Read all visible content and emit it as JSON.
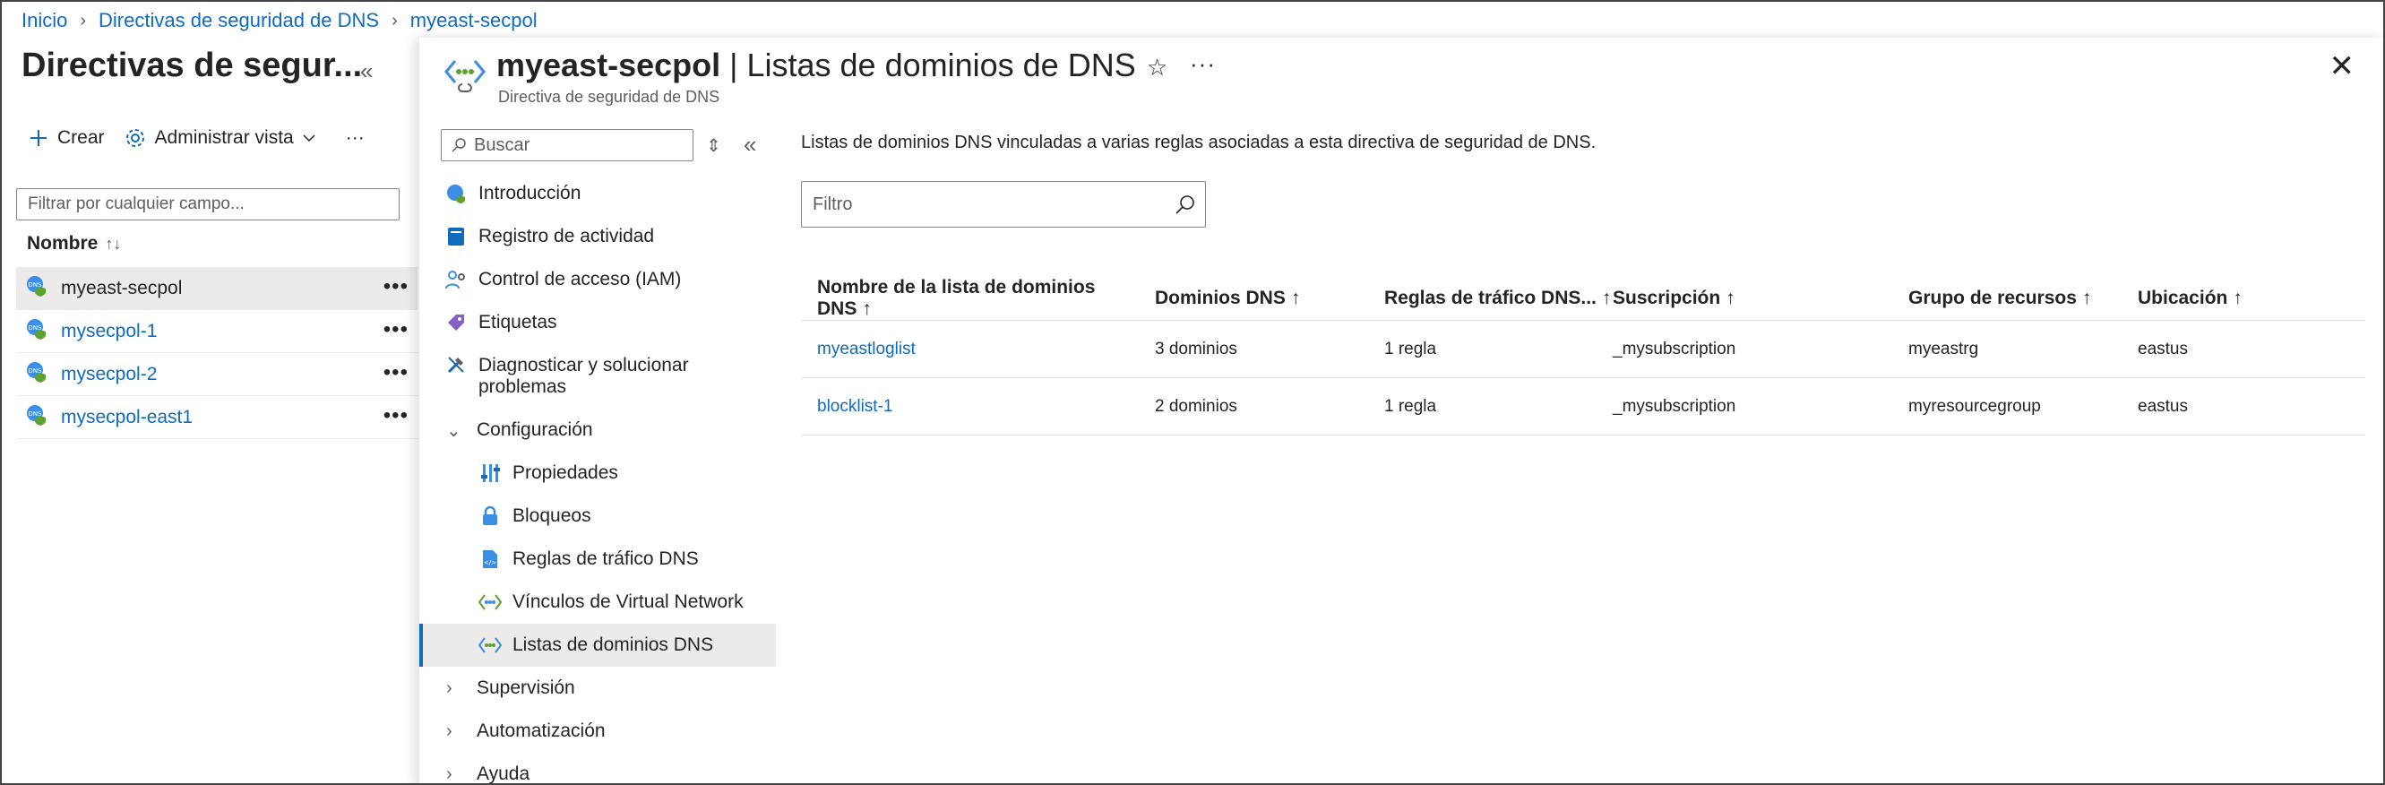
{
  "breadcrumb": [
    "Inicio",
    "Directivas de seguridad de DNS",
    "myeast-secpol"
  ],
  "left_panel": {
    "title": "Directivas de segur...",
    "collapse_icon": "«",
    "toolbar": {
      "create_label": "Crear",
      "manage_view_label": "Administrar vista",
      "more": "···"
    },
    "filter_placeholder": "Filtrar por cualquier campo...",
    "column_name": "Nombre",
    "items": [
      {
        "name": "myeast-secpol",
        "selected": true
      },
      {
        "name": "mysecpol-1",
        "selected": false
      },
      {
        "name": "mysecpol-2",
        "selected": false
      },
      {
        "name": "mysecpol-east1",
        "selected": false
      }
    ]
  },
  "blade": {
    "resource_name": "myeast-secpol",
    "separator": " | ",
    "page_name": "Listas de dominios de DNS",
    "subtitle": "Directiva de seguridad de DNS",
    "star_icon": "☆",
    "more": "···",
    "close_icon": "✕"
  },
  "nav": {
    "search_placeholder": "Buscar",
    "items": [
      {
        "label": "Introducción",
        "icon": "overview-icon"
      },
      {
        "label": "Registro de actividad",
        "icon": "activity-log-icon"
      },
      {
        "label": "Control de acceso (IAM)",
        "icon": "iam-icon"
      },
      {
        "label": "Etiquetas",
        "icon": "tags-icon"
      },
      {
        "label": "Diagnosticar y solucionar problemas",
        "icon": "diagnose-icon"
      },
      {
        "label": "Configuración",
        "icon": "chevron-down-icon"
      },
      {
        "label": "Propiedades",
        "icon": "properties-icon"
      },
      {
        "label": "Bloqueos",
        "icon": "lock-icon"
      },
      {
        "label": "Reglas de tráfico DNS",
        "icon": "rules-icon"
      },
      {
        "label": "Vínculos de Virtual Network",
        "icon": "vnet-link-icon"
      },
      {
        "label": "Listas de dominios DNS",
        "icon": "domain-list-icon"
      },
      {
        "label": "Supervisión",
        "icon": "chevron-right-icon"
      },
      {
        "label": "Automatización",
        "icon": "chevron-right-icon"
      },
      {
        "label": "Ayuda",
        "icon": "chevron-right-icon"
      }
    ]
  },
  "content": {
    "description": "Listas de dominios DNS vinculadas a varias reglas asociadas a esta directiva de seguridad de DNS.",
    "filter_placeholder": "Filtro",
    "columns": [
      "Nombre de la lista de dominios DNS",
      "Dominios DNS",
      "Reglas de tráfico DNS...",
      "Suscripción",
      "Grupo de recursos",
      "Ubicación"
    ],
    "sort_arrow": "↑",
    "rows": [
      [
        "myeastloglist",
        "3 dominios",
        "1 regla",
        "_mysubscription",
        "myeastrg",
        "eastus"
      ],
      [
        "blocklist-1",
        "2 dominios",
        "1 regla",
        "_mysubscription",
        "myresourcegroup",
        "eastus"
      ]
    ]
  },
  "colors": {
    "accent": "#0f6cbd",
    "selection": "#edebe9",
    "text": "#242424"
  }
}
